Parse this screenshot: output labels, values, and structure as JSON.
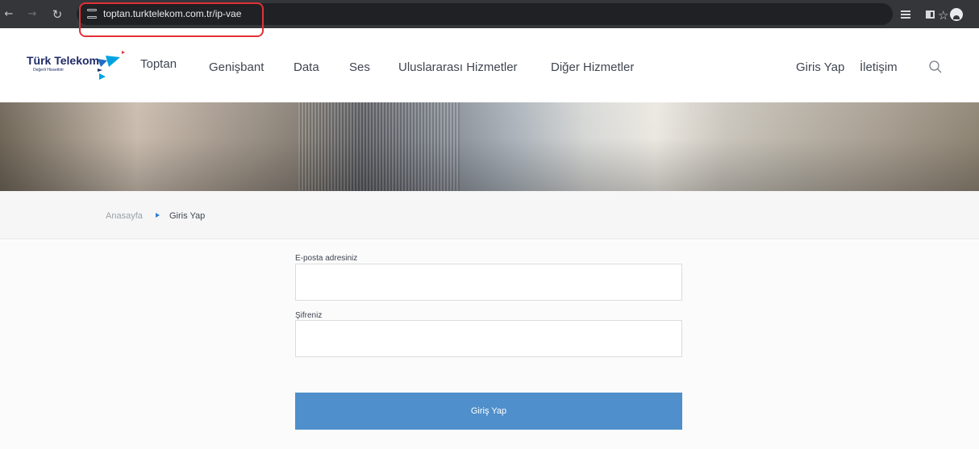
{
  "browser": {
    "url": "toptan.turktelekom.com.tr/ip-vae",
    "back_icon": "arrow-left-icon",
    "forward_icon": "arrow-right-icon",
    "reload_icon": "reload-icon",
    "site_info_icon": "site-settings-icon",
    "bookmark_icon": "star-icon",
    "extensions": [
      "reading-list-icon",
      "side-panel-icon",
      "profile-icon"
    ],
    "highlight_color": "#e13136"
  },
  "header": {
    "logo_brand": "Türk Telekom",
    "logo_slogan": "Değerli Hissettirir",
    "logo_sub": "Toptan",
    "nav": [
      "Genişbant",
      "Data",
      "Ses",
      "Uluslararası Hizmetler",
      "Diğer Hizmetler"
    ],
    "login": "Giris Yap",
    "contact": "İletişim",
    "search_icon": "search-icon"
  },
  "breadcrumb": {
    "home": "Anasayfa",
    "current": "Giris Yap"
  },
  "form": {
    "email_label": "E-posta adresiniz",
    "email_value": "",
    "password_label": "Şifreniz",
    "password_value": "",
    "submit": "Giriş Yap"
  },
  "colors": {
    "chrome_bg": "#35363a",
    "brand_navy": "#1f2a66",
    "brand_blue": "#00a3e0",
    "button_blue": "#4f8fcb"
  }
}
